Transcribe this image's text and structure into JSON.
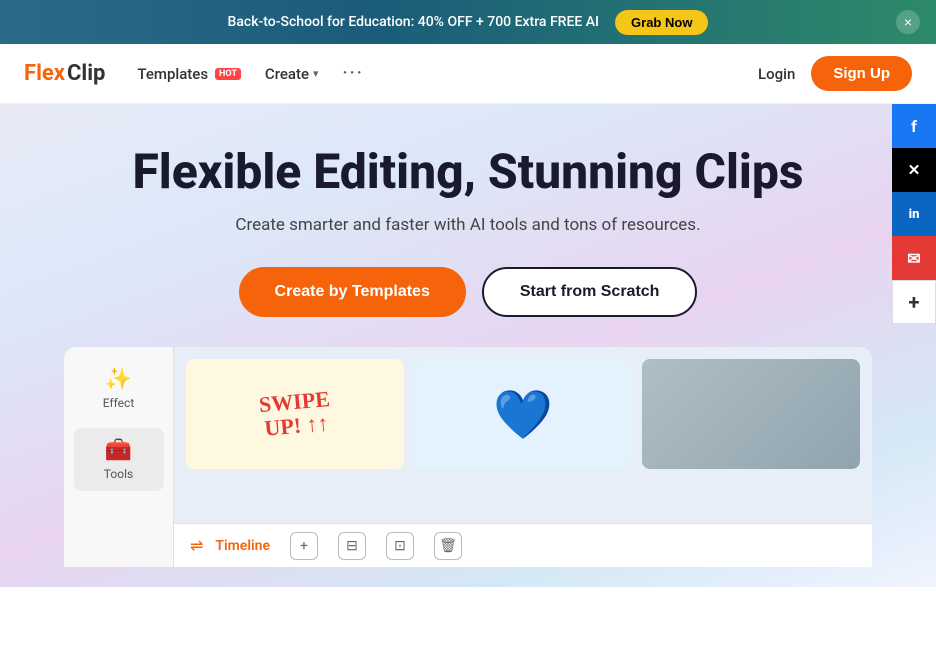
{
  "banner": {
    "text": "Back-to-School for Education: 40% OFF + 700 Extra FREE AI",
    "cta_label": "Grab Now",
    "close_label": "×"
  },
  "navbar": {
    "logo_flex": "Flex",
    "logo_clip": "Clip",
    "templates_label": "Templates",
    "hot_badge": "HOT",
    "create_label": "Create",
    "more_label": "···",
    "login_label": "Login",
    "signup_label": "Sign Up"
  },
  "hero": {
    "title": "Flexible Editing, Stunning Clips",
    "subtitle": "Create smarter and faster with AI tools and tons of resources.",
    "btn_templates": "Create by Templates",
    "btn_scratch": "Start from Scratch"
  },
  "preview": {
    "sidebar_items": [
      {
        "label": "Effect",
        "icon": "✨"
      },
      {
        "label": "Tools",
        "icon": "🧰"
      }
    ],
    "timeline_label": "Timeline",
    "card1_text": "SWIPE UP!",
    "card1_arrow": "↑",
    "bottom_buttons": [
      "+",
      "⊟",
      "⊡",
      "🗑"
    ]
  },
  "social": {
    "items": [
      {
        "id": "fb",
        "label": "f",
        "name": "facebook"
      },
      {
        "id": "tw",
        "label": "𝕏",
        "name": "twitter-x"
      },
      {
        "id": "li",
        "label": "in",
        "name": "linkedin"
      },
      {
        "id": "mail",
        "label": "✉",
        "name": "email"
      },
      {
        "id": "plus",
        "label": "+",
        "name": "more"
      }
    ]
  }
}
